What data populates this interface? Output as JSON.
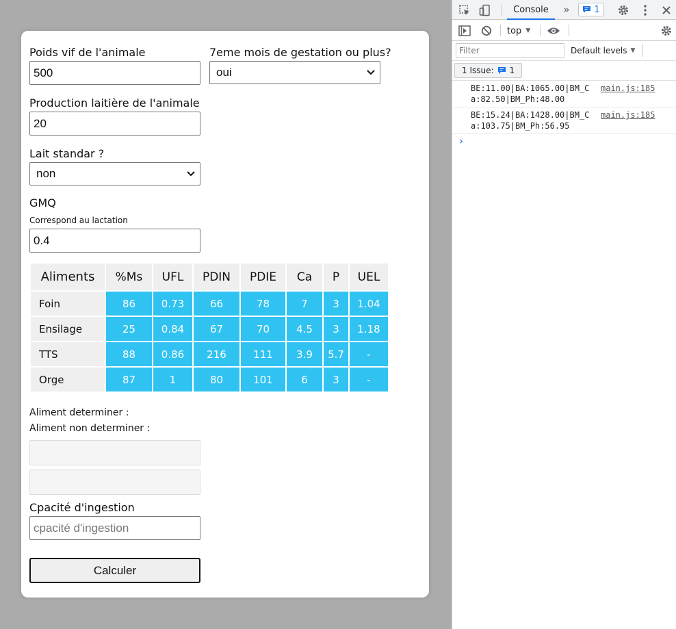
{
  "form": {
    "poids_label": "Poids vif de l'animale",
    "poids_value": "500",
    "gestation_label": "7eme mois de gestation ou plus?",
    "gestation_value": "oui",
    "production_label": "Production laitière de l'animale",
    "production_value": "20",
    "lait_label": "Lait standar ?",
    "lait_value": "non",
    "gmq_label": "GMQ",
    "gmq_sub": "Correspond au lactation",
    "gmq_value": "0.4",
    "aliment_det_label": "Aliment determiner :",
    "aliment_nondet_label": "Aliment non determiner :",
    "capacite_label": "Cpacité d'ingestion",
    "capacite_placeholder": "cpacité d'ingestion",
    "submit_label": "Calculer"
  },
  "table": {
    "headers": [
      "Aliments",
      "%Ms",
      "UFL",
      "PDIN",
      "PDIE",
      "Ca",
      "P",
      "UEL"
    ],
    "rows": [
      {
        "name": "Foin",
        "values": [
          "86",
          "0.73",
          "66",
          "78",
          "7",
          "3",
          "1.04"
        ]
      },
      {
        "name": "Ensilage",
        "values": [
          "25",
          "0.84",
          "67",
          "70",
          "4.5",
          "3",
          "1.18"
        ]
      },
      {
        "name": "TTS",
        "values": [
          "88",
          "0.86",
          "216",
          "111",
          "3.9",
          "5.7",
          "-"
        ]
      },
      {
        "name": "Orge",
        "values": [
          "87",
          "1",
          "80",
          "101",
          "6",
          "3",
          "-"
        ]
      }
    ]
  },
  "devtools": {
    "tab_console": "Console",
    "issues_badge_count": "1",
    "context": "top",
    "filter_placeholder": "Filter",
    "levels": "Default levels",
    "issues_label": "1 Issue:",
    "issues_count": "1",
    "logs": [
      {
        "line1": "BE:11.00|BA:1065.00|BM_C",
        "line2": "a:82.50|BM_Ph:48.00",
        "source": "main.js:185"
      },
      {
        "line1": "BE:15.24|BA:1428.00|BM_C",
        "line2": "a:103.75|BM_Ph:56.95",
        "source": "main.js:185"
      }
    ],
    "prompt": "›"
  },
  "colors": {
    "accent_cell": "#30c3f2",
    "header_cell": "#efefef",
    "page_bg": "#ababab"
  }
}
